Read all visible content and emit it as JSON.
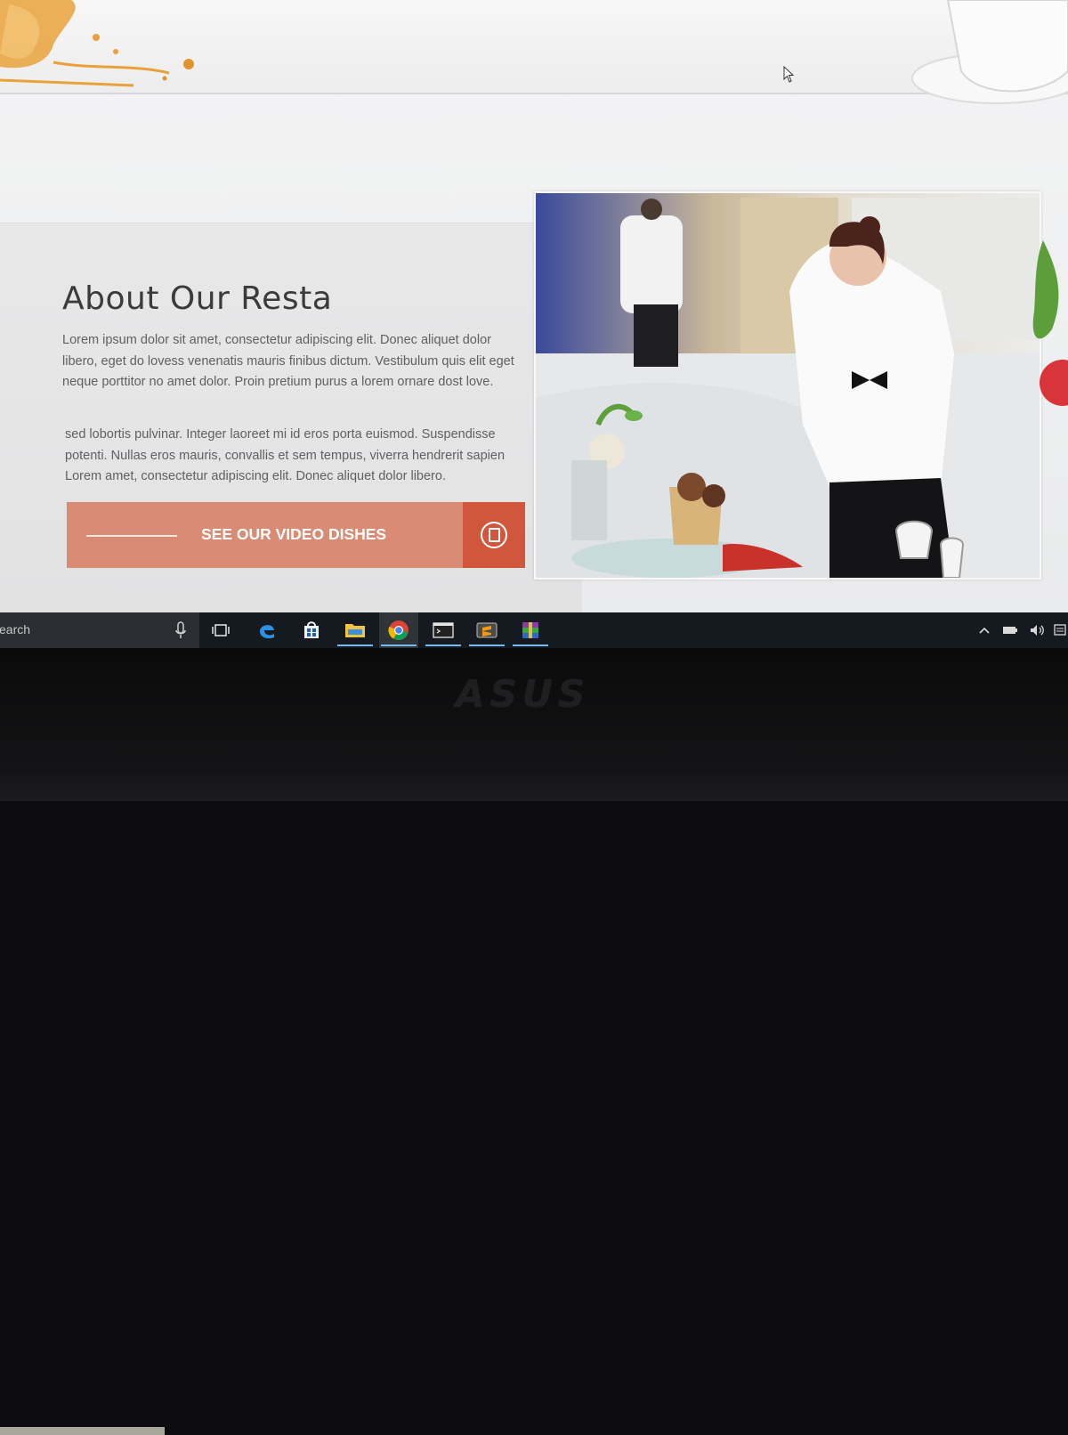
{
  "about": {
    "title": "About Our Resta",
    "paragraph1": "Lorem ipsum dolor sit amet, consectetur adipiscing elit. Donec aliquet dolor libero, eget do lovess venenatis mauris finibus dictum. Vestibulum quis elit eget neque porttitor no amet dolor. Proin pretium purus a lorem ornare dost love.",
    "paragraph2": "sed lobortis pulvinar. Integer laoreet mi id eros porta euismod. Suspendisse potenti. Nullas eros mauris, convallis et sem tempus, viverra hendrerit sapien Lorem amet, consectetur adipiscing elit. Donec aliquet dolor libero.",
    "cta_label": "SEE OUR VIDEO DISHES"
  },
  "taskbar": {
    "search_placeholder": "earch",
    "apps": [
      {
        "name": "task-view",
        "active": false
      },
      {
        "name": "edge",
        "active": false
      },
      {
        "name": "store",
        "active": false
      },
      {
        "name": "file-explorer",
        "active": true
      },
      {
        "name": "chrome",
        "active": true
      },
      {
        "name": "terminal",
        "active": true
      },
      {
        "name": "sublime-text",
        "active": true
      },
      {
        "name": "winrar",
        "active": true
      }
    ]
  },
  "bezel": {
    "brand": "ASUS"
  },
  "colors": {
    "cta": "#d98c73",
    "cta_icon_box": "#d0573b",
    "taskbar": "#151a20",
    "active_indicator": "#76b9ed"
  }
}
